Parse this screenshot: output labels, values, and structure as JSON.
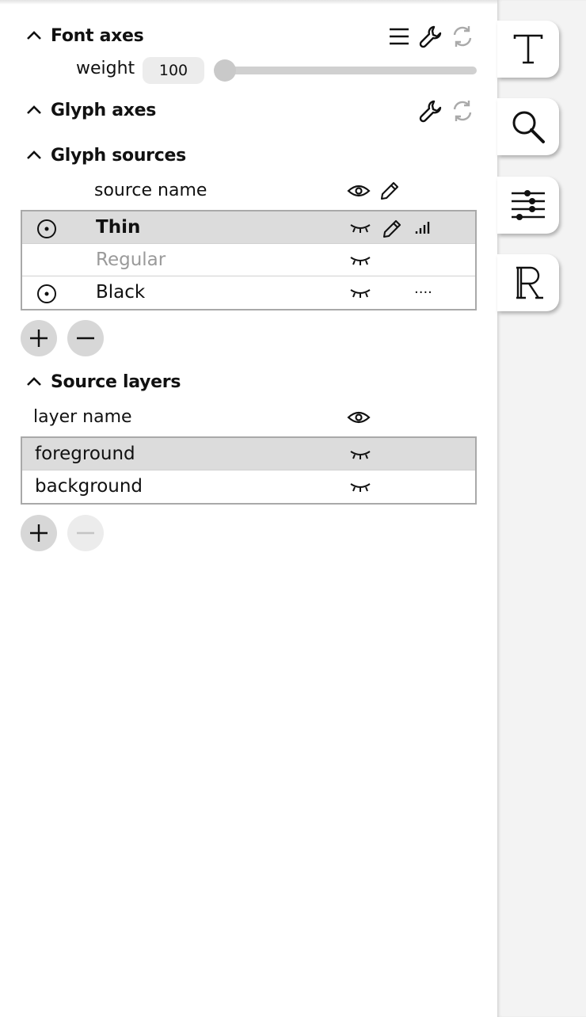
{
  "font_axes": {
    "title": "Font axes",
    "axis": {
      "label": "weight",
      "value": "100",
      "slider_fraction": 0.0
    }
  },
  "glyph_axes": {
    "title": "Glyph axes"
  },
  "glyph_sources": {
    "title": "Glyph sources",
    "column_header": "source name",
    "rows": [
      {
        "name": "Thin",
        "default": true,
        "selected": true,
        "bold": true,
        "muted": false,
        "editing": true,
        "status": "bars"
      },
      {
        "name": "Regular",
        "default": false,
        "selected": false,
        "bold": false,
        "muted": true,
        "editing": false,
        "status": ""
      },
      {
        "name": "Black",
        "default": true,
        "selected": false,
        "bold": false,
        "muted": false,
        "editing": false,
        "status": "...."
      }
    ]
  },
  "source_layers": {
    "title": "Source layers",
    "column_header": "layer name",
    "rows": [
      {
        "name": "foreground",
        "selected": true
      },
      {
        "name": "background",
        "selected": false
      }
    ]
  },
  "side_tabs": [
    "text-tab",
    "search-tab",
    "glyph-settings-tab",
    "reference-font-tab"
  ],
  "colors": {
    "selected_row": "#dcdcdc",
    "muted_text": "#9a9a9a",
    "rail": "#f3f3f3"
  }
}
